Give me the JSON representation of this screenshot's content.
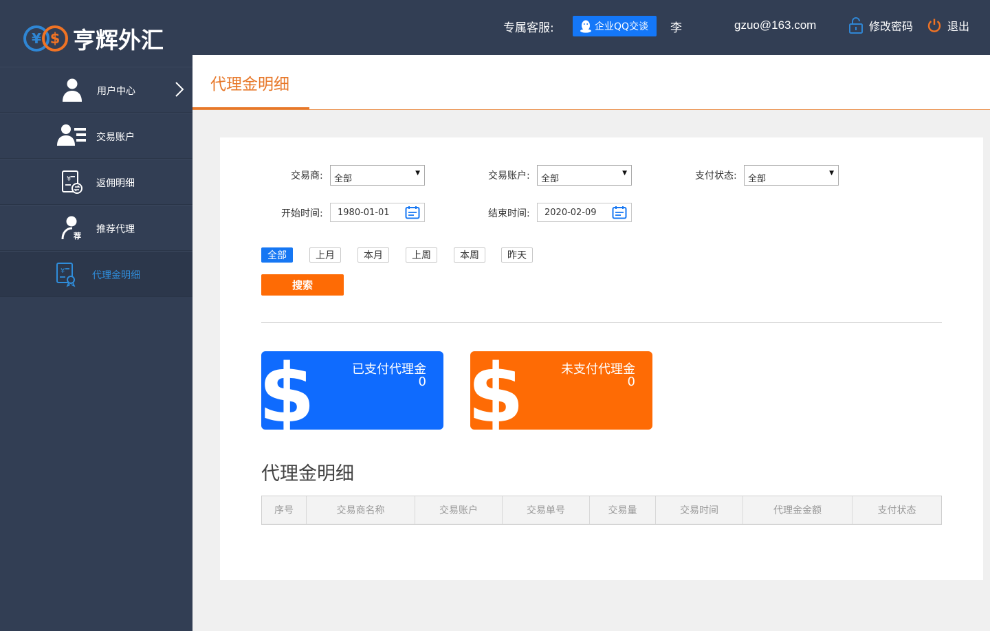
{
  "header": {
    "logo_text": "亨辉外汇",
    "service_label": "专属客服:",
    "qq_label": "企业QQ交谈",
    "user_name": "李",
    "email": "gzuo@163.com",
    "change_password": "修改密码",
    "logout": "退出"
  },
  "sidebar": {
    "items": [
      {
        "label": "用户中心",
        "icon": "user-icon"
      },
      {
        "label": "交易账户",
        "icon": "account-list-icon"
      },
      {
        "label": "返佣明细",
        "icon": "rebate-icon"
      },
      {
        "label": "推荐代理",
        "icon": "referral-icon"
      },
      {
        "label": "代理金明细",
        "icon": "agent-money-icon",
        "active": true
      }
    ]
  },
  "page": {
    "title": "代理金明细"
  },
  "filters": {
    "trader_label": "交易商:",
    "trader_value": "全部",
    "account_label": "交易账户:",
    "account_value": "全部",
    "pay_status_label": "支付状态:",
    "pay_status_value": "全部",
    "start_label": "开始时间:",
    "start_value": "1980-01-01",
    "end_label": "结束时间:",
    "end_value": "2020-02-09",
    "quick": [
      "全部",
      "上月",
      "本月",
      "上周",
      "本周",
      "昨天"
    ],
    "quick_active": "全部",
    "search_label": "搜索"
  },
  "cards": {
    "paid_title": "已支付代理金",
    "paid_value": "0",
    "unpaid_title": "未支付代理金",
    "unpaid_value": "0"
  },
  "detail": {
    "title": "代理金明细",
    "columns": [
      "序号",
      "交易商名称",
      "交易账户",
      "交易单号",
      "交易量",
      "交易时间",
      "代理金金额",
      "支付状态"
    ],
    "rows": []
  },
  "colors": {
    "sidebar_bg": "#323e54",
    "accent_orange": "#fe6b05",
    "accent_blue": "#1677f3",
    "active_sidebar_text": "#2f8ddb",
    "title_orange": "#e7782a"
  }
}
